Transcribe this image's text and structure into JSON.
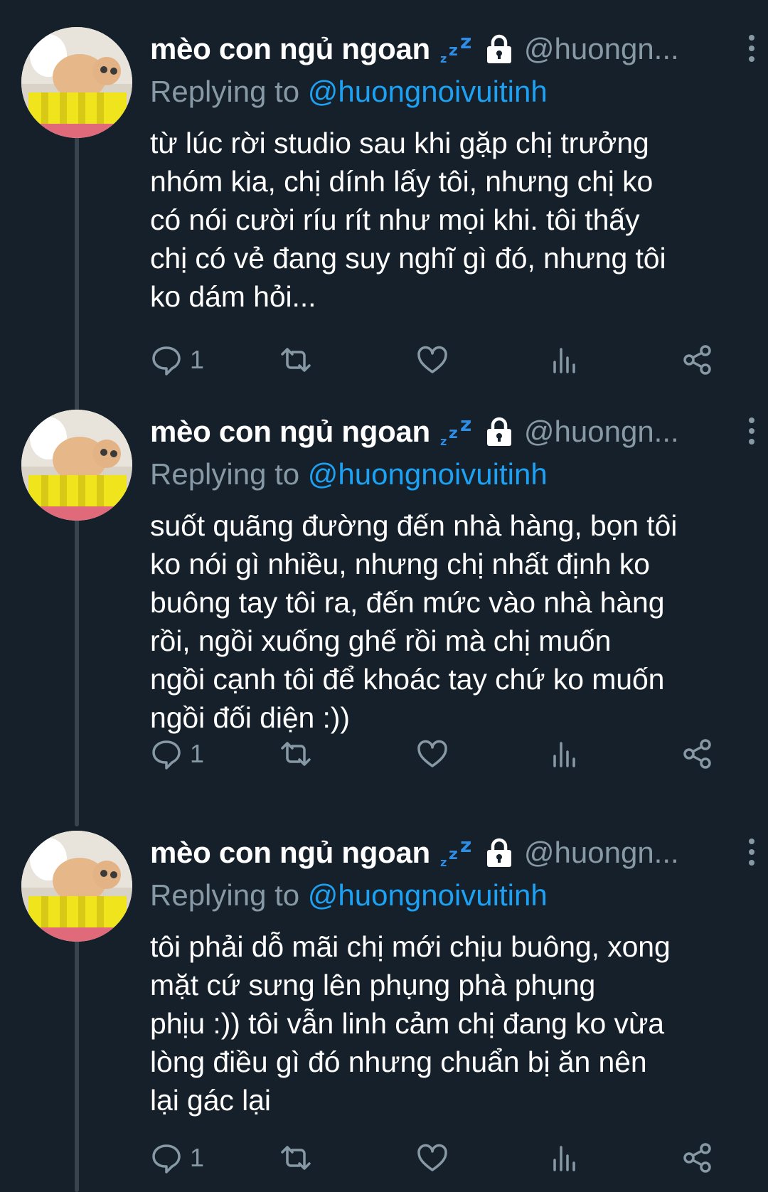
{
  "thread": {
    "tweets": [
      {
        "display_name": "mèo con ngủ ngoan",
        "handle": "@huongn...",
        "replying_prefix": "Replying to ",
        "replying_to": "@huongnoivuitinh",
        "text": "từ lúc rời studio sau khi gặp chị trưởng\nnhóm kia, chị dính lấy tôi, nhưng chị ko\ncó nói cười ríu rít như mọi khi. tôi thấy\nchị có vẻ đang suy nghĩ gì đó, nhưng tôi\nko dám hỏi...",
        "reply_count": "1"
      },
      {
        "display_name": "mèo con ngủ ngoan",
        "handle": "@huongn...",
        "replying_prefix": "Replying to ",
        "replying_to": "@huongnoivuitinh",
        "text": "suốt quãng đường đến nhà hàng, bọn tôi\nko nói gì nhiều, nhưng chị nhất định ko\nbuông tay tôi ra, đến mức vào nhà hàng\nrồi, ngồi xuống ghế rồi mà chị muốn\nngồi cạnh tôi để khoác tay chứ ko muốn\nngồi đối diện :))",
        "reply_count": "1"
      },
      {
        "display_name": "mèo con ngủ ngoan",
        "handle": "@huongn...",
        "replying_prefix": "Replying to ",
        "replying_to": "@huongnoivuitinh",
        "text": "tôi phải dỗ mãi chị mới chịu buông, xong\nmặt cứ sưng lên phụng phà phụng\nphịu :)) tôi vẫn linh cảm chị đang ko vừa\nlòng điều gì đó nhưng chuẩn bị ăn nên\nlại gác lại",
        "reply_count": "1"
      }
    ]
  },
  "icons": [
    "zzz-emoji-icon",
    "lock-icon",
    "more-vertical-icon",
    "reply-icon",
    "retweet-icon",
    "like-icon",
    "analytics-icon",
    "share-icon"
  ],
  "colors": {
    "background": "#15202b",
    "text": "#ffffff",
    "secondary": "#8899a6",
    "mention": "#1da1f2",
    "thread_line": "#38444d"
  }
}
